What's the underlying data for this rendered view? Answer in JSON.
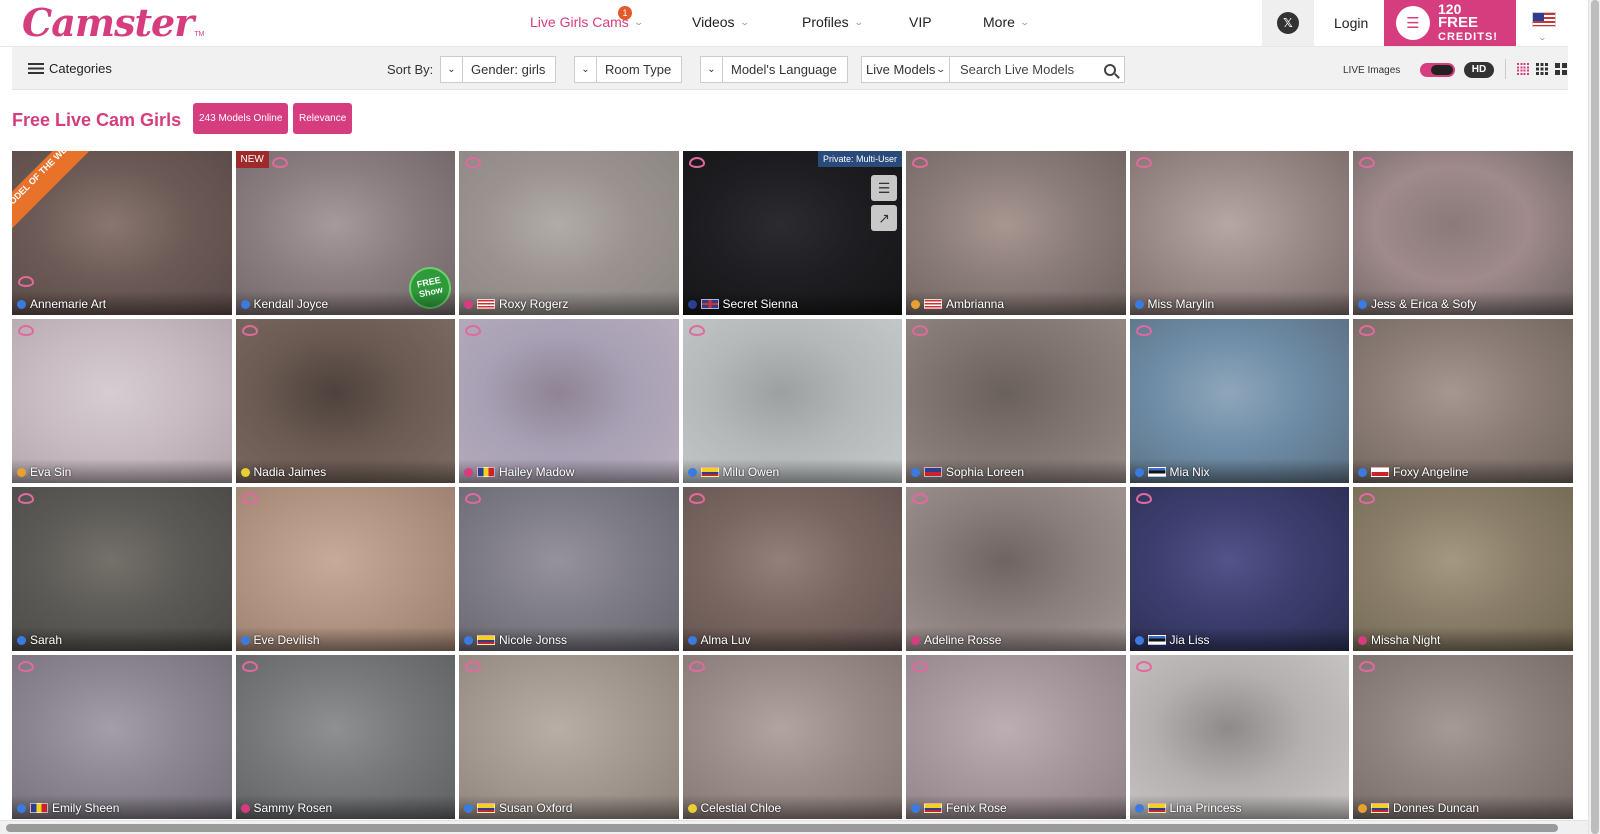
{
  "brand": {
    "name": "Camster",
    "tm": "TM"
  },
  "nav": {
    "items": [
      {
        "label": "Live Girls Cams",
        "active": true,
        "badge": "1"
      },
      {
        "label": "Videos"
      },
      {
        "label": "Profiles"
      },
      {
        "label": "VIP"
      },
      {
        "label": "More"
      }
    ],
    "login": "Login",
    "credits": {
      "line1": "120",
      "line2": "FREE",
      "line3": "CREDITS!"
    }
  },
  "filters": {
    "categories": "Categories",
    "sort_by": "Sort By:",
    "gender": "Gender: girls",
    "room_type": "Room Type",
    "language": "Model's Language",
    "scope": "Live Models",
    "search_placeholder": "Search Live Models",
    "live_images": "LIVE Images",
    "hd": "HD"
  },
  "heading": {
    "title": "Free Live Cam Girls",
    "models_online": "243 Models Online",
    "sort": "Relevance"
  },
  "colors": {
    "accent": "#d63d7f",
    "ribbon": "#e8722a",
    "private": "#2a4a7a"
  },
  "tiles": [
    {
      "name": "Annemarie Art",
      "dot": "#3b7be0",
      "ribbon": "MODEL OF THE WEEK",
      "bg": [
        "#6b5a55",
        "#8a7670",
        "#5a4a48"
      ]
    },
    {
      "name": "Kendall Joyce",
      "dot": "#3b7be0",
      "badge": "NEW",
      "freeshow": "FREE Show",
      "bg": [
        "#8a7e80",
        "#a79a9c",
        "#6f6466"
      ]
    },
    {
      "name": "Roxy Rogerz",
      "dot": "#d63d7f",
      "flag": "us",
      "bg": [
        "#9a9390",
        "#b2aca8",
        "#8a8480"
      ]
    },
    {
      "name": "Secret Sienna",
      "dot": "#2a3f8f",
      "flag": "gb",
      "private": "Private: Multi-User",
      "bg": [
        "#1e1e22",
        "#2c2c30",
        "#141416"
      ]
    },
    {
      "name": "Ambrianna",
      "dot": "#e8a030",
      "flag": "us",
      "bg": [
        "#8a7c78",
        "#a89690",
        "#706460"
      ]
    },
    {
      "name": "Miss Marylin",
      "dot": "#3b7be0",
      "bg": [
        "#9a8a88",
        "#b6a6a4",
        "#7a6c6a"
      ]
    },
    {
      "name": "Jess & Erica & Sofy",
      "dot": "#3b7be0",
      "bg": [
        "#a08a8c",
        "#8a7a78",
        "#6e6462"
      ]
    },
    {
      "name": "Eva Sin",
      "dot": "#e8a030",
      "bg": [
        "#c8bcc2",
        "#d6ccd2",
        "#b0a4aa"
      ]
    },
    {
      "name": "Nadia Jaimes",
      "dot": "#e8d030",
      "bg": [
        "#6a5a52",
        "#4e423c",
        "#7e6c64"
      ]
    },
    {
      "name": "Hailey Madow",
      "dot": "#d63d7f",
      "flag": "ro",
      "bg": [
        "#a8a0b4",
        "#8e8494",
        "#b8aebe"
      ]
    },
    {
      "name": "Milu Owen",
      "dot": "#3b7be0",
      "flag": "co",
      "bg": [
        "#b4b8b8",
        "#9ca0a0",
        "#c6cacc"
      ]
    },
    {
      "name": "Sophia Loreen",
      "dot": "#3b7be0",
      "flag": "cl",
      "bg": [
        "#807470",
        "#6a605c",
        "#968a86"
      ]
    },
    {
      "name": "Mia Nix",
      "dot": "#3b7be0",
      "flag": "ee",
      "bg": [
        "#6e8ca6",
        "#8ea6ba",
        "#5a6e80"
      ]
    },
    {
      "name": "Foxy Angeline",
      "dot": "#3b7be0",
      "flag": "cz",
      "bg": [
        "#8c7e76",
        "#a69890",
        "#70645e"
      ]
    },
    {
      "name": "Sarah",
      "dot": "#3b7be0",
      "bg": [
        "#5c5a56",
        "#74706a",
        "#4a4844"
      ]
    },
    {
      "name": "Eve Devilish",
      "dot": "#3b7be0",
      "bg": [
        "#b49684",
        "#c8aa98",
        "#9a7e6e"
      ]
    },
    {
      "name": "Nicole Jonss",
      "dot": "#3b7be0",
      "flag": "co",
      "bg": [
        "#7e7c84",
        "#96929c",
        "#66646c"
      ]
    },
    {
      "name": "Alma Luv",
      "dot": "#3b7be0",
      "bg": [
        "#7a6660",
        "#94807a",
        "#625250"
      ]
    },
    {
      "name": "Adeline Rosse",
      "dot": "#d63d7f",
      "bg": [
        "#8a7e7c",
        "#6e6462",
        "#a29694"
      ]
    },
    {
      "name": "Jia Liss",
      "dot": "#3b7be0",
      "flag": "ee",
      "bg": [
        "#3c3e6e",
        "#52548a",
        "#2c2e54"
      ]
    },
    {
      "name": "Missha Night",
      "dot": "#d63d7f",
      "bg": [
        "#8a7e6a",
        "#a49880",
        "#726852"
      ]
    },
    {
      "name": "Emily Sheen",
      "dot": "#3b7be0",
      "flag": "ro",
      "bg": [
        "#8c8690",
        "#a49ea8",
        "#746e78"
      ]
    },
    {
      "name": "Sammy Rosen",
      "dot": "#d63d7f",
      "bg": [
        "#76787a",
        "#8e9092",
        "#5e6062"
      ]
    },
    {
      "name": "Susan Oxford",
      "dot": "#3b7be0",
      "flag": "co",
      "bg": [
        "#a49a92",
        "#b8aea6",
        "#8c827a"
      ]
    },
    {
      "name": "Celestial Chloe",
      "dot": "#e8d030",
      "bg": [
        "#9a8c88",
        "#b2a4a0",
        "#827470"
      ]
    },
    {
      "name": "Fenix Rose",
      "dot": "#3b7be0",
      "flag": "co",
      "bg": [
        "#a6989c",
        "#bcaeb2",
        "#8e8084"
      ]
    },
    {
      "name": "Lina Princess",
      "dot": "#3b7be0",
      "flag": "co",
      "bg": [
        "#b4b0b0",
        "#8e8a8a",
        "#cac6c6"
      ]
    },
    {
      "name": "Donnes Duncan",
      "dot": "#e8a030",
      "flag": "co",
      "bg": [
        "#8e827e",
        "#a69a96",
        "#766a66"
      ]
    }
  ]
}
